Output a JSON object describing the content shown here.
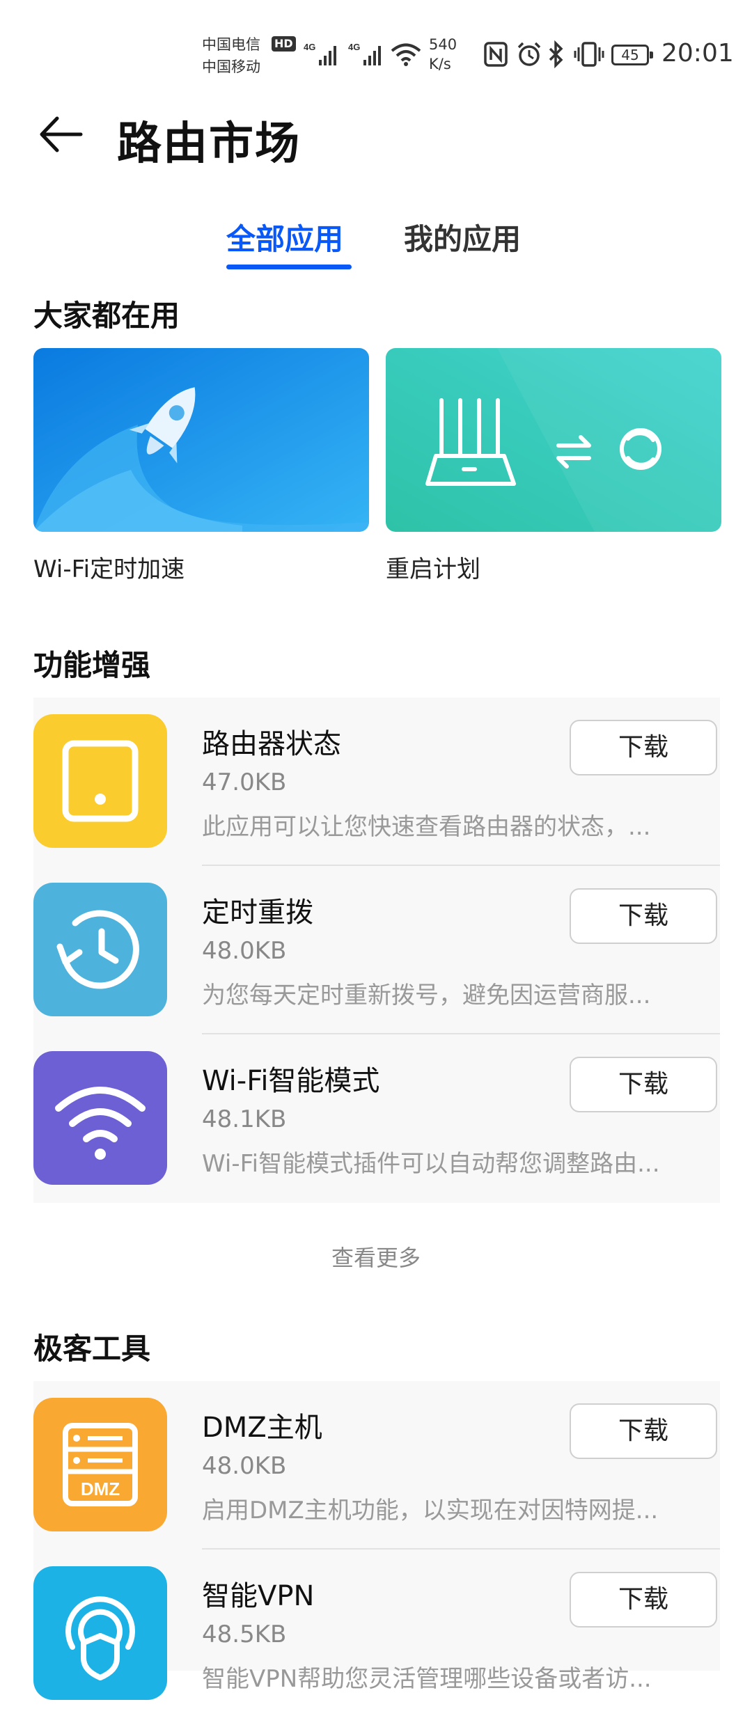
{
  "status_bar": {
    "carrier1": "中国电信",
    "carrier2": "中国移动",
    "hd": "HD",
    "net1": "4G",
    "net2": "4G",
    "speed_value": "540",
    "speed_unit": "K/s",
    "battery": "45",
    "time": "20:01"
  },
  "header": {
    "title": "路由市场"
  },
  "tabs": [
    {
      "label": "全部应用",
      "active": true
    },
    {
      "label": "我的应用",
      "active": false
    }
  ],
  "popular": {
    "title": "大家都在用",
    "items": [
      {
        "label": "Wi-Fi定时加速",
        "icon": "rocket-icon"
      },
      {
        "label": "重启计划",
        "icon": "router-restart-icon"
      }
    ]
  },
  "enhance": {
    "title": "功能增强",
    "apps": [
      {
        "name": "路由器状态",
        "size": "47.0KB",
        "desc": "此应用可以让您快速查看路由器的状态，...",
        "action": "下载",
        "icon": "router-status-icon",
        "color": "#fbcc2d"
      },
      {
        "name": "定时重拨",
        "size": "48.0KB",
        "desc": "为您每天定时重新拨号，避免因运营商服...",
        "action": "下载",
        "icon": "clock-redial-icon",
        "color": "#4eb3dc"
      },
      {
        "name": "Wi-Fi智能模式",
        "size": "48.1KB",
        "desc": "Wi-Fi智能模式插件可以自动帮您调整路由...",
        "action": "下载",
        "icon": "wifi-icon",
        "color": "#6d5fd4"
      }
    ],
    "more": "查看更多"
  },
  "geek": {
    "title": "极客工具",
    "apps": [
      {
        "name": "DMZ主机",
        "size": "48.0KB",
        "desc": "启用DMZ主机功能，以实现在对因特网提...",
        "action": "下载",
        "icon": "dmz-server-icon",
        "color": "#f9a932",
        "icon_text": "DMZ"
      },
      {
        "name": "智能VPN",
        "size": "48.5KB",
        "desc": "智能VPN帮助您灵活管理哪些设备或者访...",
        "action": "下载",
        "icon": "vpn-shield-icon",
        "color": "#1cb2e6"
      }
    ]
  }
}
